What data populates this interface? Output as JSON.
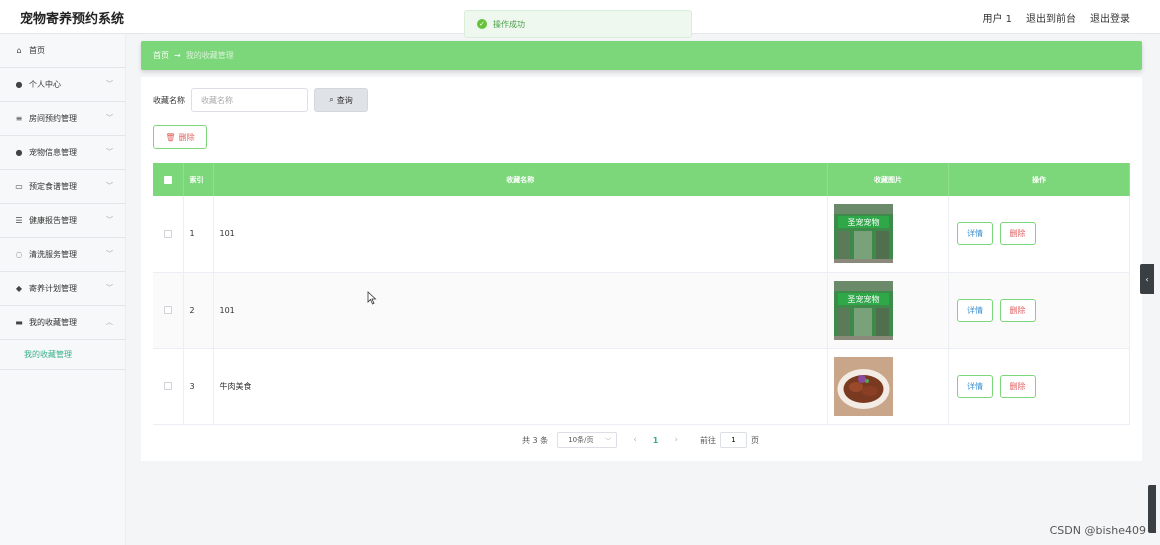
{
  "app": {
    "title": "宠物寄养预约系统"
  },
  "header": {
    "user": "用户 1",
    "back_front": "退出到前台",
    "logout": "退出登录"
  },
  "toast": {
    "message": "操作成功",
    "color": "#67c23a"
  },
  "sidebar": {
    "items": [
      {
        "label": "首页",
        "icon": "home-icon",
        "glyph": "⌂"
      },
      {
        "label": "个人中心",
        "icon": "user-icon",
        "glyph": "●"
      },
      {
        "label": "房间预约管理",
        "icon": "list-icon",
        "glyph": "≡"
      },
      {
        "label": "宠物信息管理",
        "icon": "user-icon",
        "glyph": "●"
      },
      {
        "label": "预定食谱管理",
        "icon": "chat-icon",
        "glyph": "▭"
      },
      {
        "label": "健康报告管理",
        "icon": "sliders-icon",
        "glyph": "☰"
      },
      {
        "label": "清洗服务管理",
        "icon": "power-icon",
        "glyph": "◌"
      },
      {
        "label": "寄养计划管理",
        "icon": "location-icon",
        "glyph": "◆"
      },
      {
        "label": "我的收藏管理",
        "icon": "message-icon",
        "glyph": "▬"
      }
    ],
    "sub_item": "我的收藏管理"
  },
  "breadcrumb": {
    "home": "首页",
    "arrow": "→",
    "current": "我的收藏管理"
  },
  "search": {
    "label": "收藏名称",
    "placeholder": "收藏名称",
    "value": "",
    "button": "查询"
  },
  "actions": {
    "delete": "删除"
  },
  "table": {
    "headers": {
      "index": "索引",
      "name": "收藏名称",
      "image": "收藏图片",
      "ops": "操作"
    },
    "rows": [
      {
        "index": "1",
        "name": "101",
        "image": "storefront-photo"
      },
      {
        "index": "2",
        "name": "101",
        "image": "storefront-photo"
      },
      {
        "index": "3",
        "name": "牛肉美食",
        "image": "beef-dish-photo"
      }
    ],
    "detail_label": "详情",
    "delete_label": "删除"
  },
  "pagination": {
    "total": "共 3 条",
    "page_size": "10条/页",
    "current_page": "1",
    "goto_label": "前往",
    "goto_value": "1",
    "page_unit": "页"
  },
  "watermark": "CSDN @bishe409",
  "colors": {
    "accent_green": "#7bd77a",
    "text_green": "#3ab08a",
    "danger": "#e06060"
  }
}
